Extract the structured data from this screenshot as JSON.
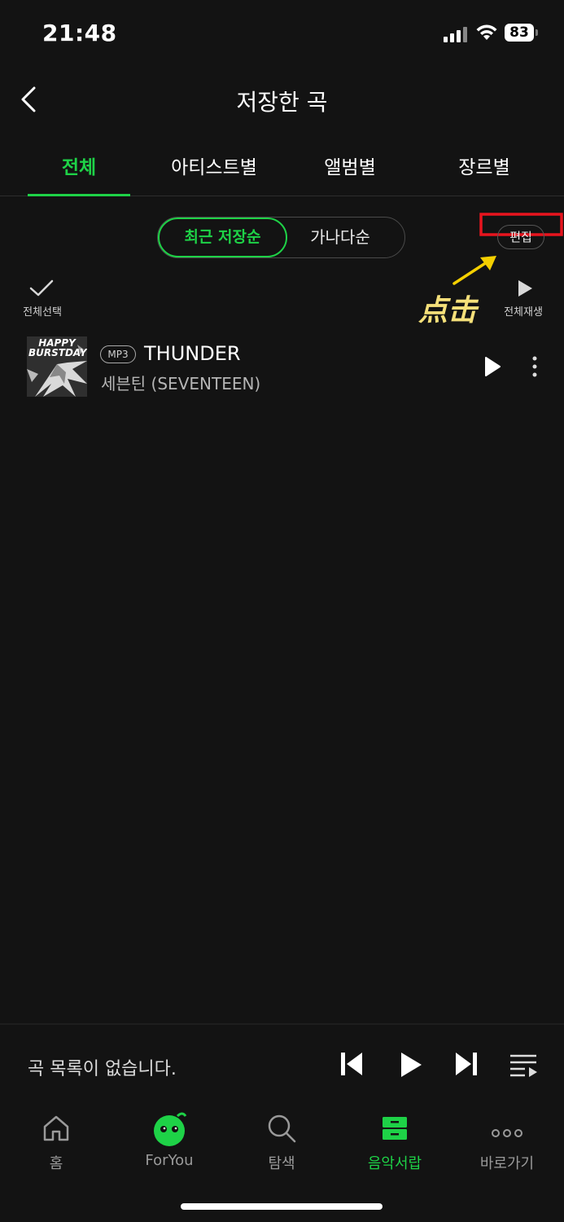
{
  "status_bar": {
    "time": "21:48",
    "battery": "83"
  },
  "header": {
    "title": "저장한 곡"
  },
  "tabs": [
    {
      "label": "전체",
      "active": true
    },
    {
      "label": "아티스트별",
      "active": false
    },
    {
      "label": "앨범별",
      "active": false
    },
    {
      "label": "장르별",
      "active": false
    }
  ],
  "sort": {
    "recent": "최근 저장순",
    "alphabetical": "가나다순"
  },
  "edit_label": "편집",
  "annotation": "点击",
  "select_all_label": "전체선택",
  "play_all_label": "전체재생",
  "songs": [
    {
      "format": "MP3",
      "title": "THUNDER",
      "artist": "세븐틴 (SEVENTEEN)",
      "album_art_text": "HAPPY BURSTDAY"
    }
  ],
  "player": {
    "empty_text": "곡 목록이 없습니다."
  },
  "nav": [
    {
      "label": "홈",
      "icon": "home-icon",
      "active": false
    },
    {
      "label": "ForYou",
      "icon": "foryou-character-icon",
      "active": false
    },
    {
      "label": "탐색",
      "icon": "search-icon",
      "active": false
    },
    {
      "label": "음악서랍",
      "icon": "music-drawer-icon",
      "active": true
    },
    {
      "label": "바로가기",
      "icon": "more-dots-icon",
      "active": false
    }
  ],
  "colors": {
    "accent": "#1ed247",
    "background": "#131313",
    "highlight_box": "#e8141e",
    "annotation": "#f5e07a"
  }
}
